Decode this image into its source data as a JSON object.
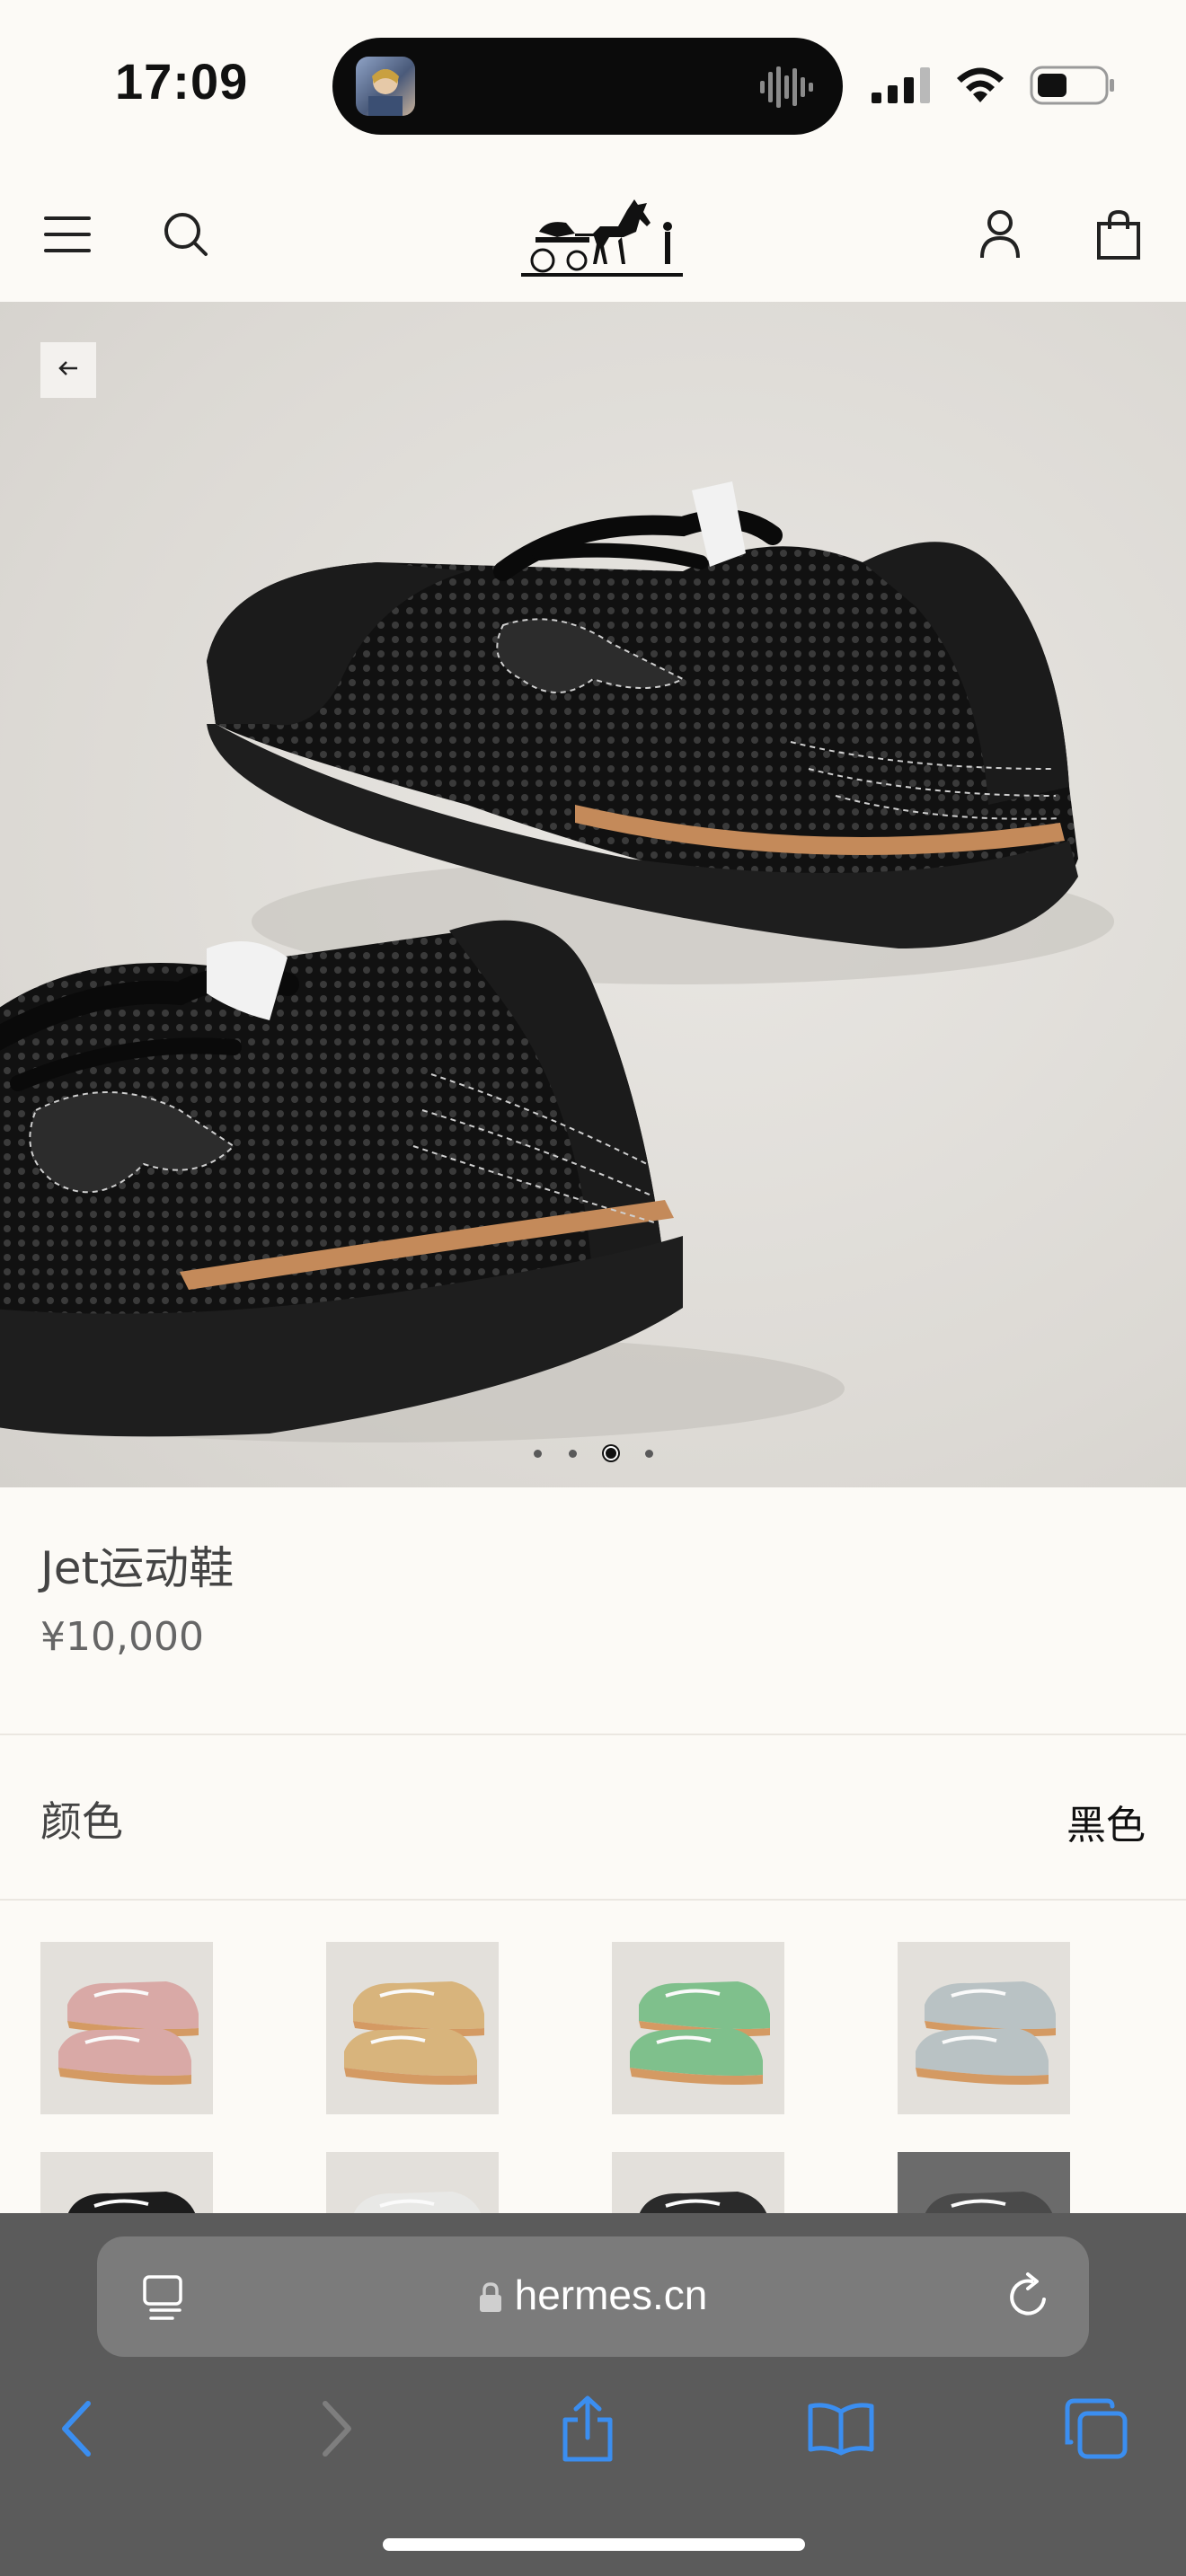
{
  "status_bar": {
    "time": "17:09"
  },
  "header": {
    "menu_icon": "hamburger-icon",
    "search_icon": "search-icon",
    "logo_icon": "horse-carriage-logo",
    "account_icon": "user-icon",
    "bag_icon": "shopping-bag-icon"
  },
  "gallery": {
    "back_icon": "arrow-left-icon",
    "image_count": 4,
    "active_index": 2
  },
  "product": {
    "name": "Jet运动鞋",
    "price": "¥10,000"
  },
  "color": {
    "label": "颜色",
    "selected": "黑色"
  },
  "swatches": [
    {
      "color": "#d9a9a6",
      "sole": "#d49a63"
    },
    {
      "color": "#d8b47c",
      "sole": "#d49a63"
    },
    {
      "color": "#7fc08c",
      "sole": "#d49a63"
    },
    {
      "color": "#b9c2c4",
      "sole": "#d49a63"
    },
    {
      "color": "#1c1c1c",
      "sole": "#1c1c1c"
    },
    {
      "color": "#e8e8e6",
      "sole": "#cfcfcf"
    },
    {
      "color": "#2a2a2a",
      "sole": "#2a2a2a"
    },
    {
      "color": "#4a4a4a",
      "sole": "#3a3a3a"
    }
  ],
  "browser": {
    "url": "hermes.cn",
    "reader_icon": "reader-mode-icon",
    "reload_icon": "reload-icon",
    "back_icon": "chevron-left-icon",
    "forward_icon": "chevron-right-icon",
    "share_icon": "share-icon",
    "bookmarks_icon": "book-icon",
    "tabs_icon": "tabs-icon",
    "accent": "#3b8ef0"
  }
}
